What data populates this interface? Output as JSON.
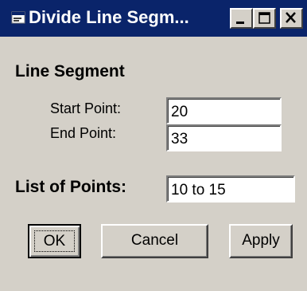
{
  "window": {
    "title": "Divide Line Segm...",
    "colors": {
      "titlebar": "#0a246a",
      "face": "#d4d0c8"
    }
  },
  "icons": {
    "app": "app-icon",
    "minimize": "minimize-icon",
    "maximize": "maximize-icon",
    "close": "close-icon"
  },
  "section": {
    "heading": "Line Segment"
  },
  "start_point": {
    "label": "Start Point:",
    "value": "20"
  },
  "end_point": {
    "label": "End Point:",
    "value": "33"
  },
  "list_of_points": {
    "label": "List of Points:",
    "value": "10 to 15"
  },
  "buttons": {
    "ok": "OK",
    "cancel": "Cancel",
    "apply": "Apply"
  }
}
